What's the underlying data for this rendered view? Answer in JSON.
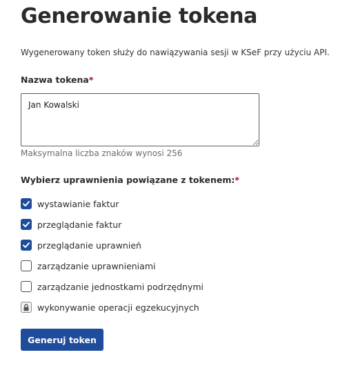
{
  "page": {
    "title": "Generowanie tokena",
    "description": "Wygenerowany token służy do nawiązywania sesji w KSeF przy użyciu API."
  },
  "token_name": {
    "label": "Nazwa tokena",
    "required_mark": "*",
    "value": "Jan Kowalski",
    "hint": "Maksymalna liczba znaków wynosi 256"
  },
  "permissions": {
    "label": "Wybierz uprawnienia powiązane z tokenem:",
    "required_mark": "*",
    "items": [
      {
        "label": "wystawianie faktur",
        "state": "checked"
      },
      {
        "label": "przeglądanie faktur",
        "state": "checked"
      },
      {
        "label": "przeglądanie uprawnień",
        "state": "checked"
      },
      {
        "label": "zarządzanie uprawnieniami",
        "state": "unchecked"
      },
      {
        "label": "zarządzanie jednostkami podrzędnymi",
        "state": "unchecked"
      },
      {
        "label": "wykonywanie operacji egzekucyjnych",
        "state": "locked"
      }
    ]
  },
  "actions": {
    "submit_label": "Generuj token"
  },
  "colors": {
    "primary": "#1f4d9b",
    "required": "#b00030",
    "text": "#2b2b2b",
    "hint": "#6b6b6b"
  }
}
